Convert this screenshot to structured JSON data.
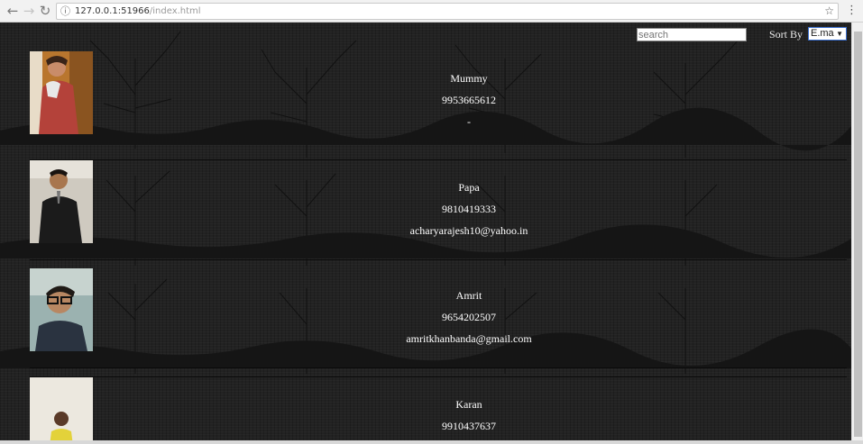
{
  "browser": {
    "url_host": "127.0.0.1:51966",
    "url_path": "/index.html",
    "star_icon": "star-icon",
    "menu_icon": "more-vert-icon"
  },
  "toolbar": {
    "search_placeholder": "search",
    "sort_label": "Sort By",
    "sort_value": "E.ma"
  },
  "contacts": [
    {
      "name": "Mummy",
      "phone": "9953665612",
      "email": "-"
    },
    {
      "name": "Papa",
      "phone": "9810419333",
      "email": "acharyarajesh10@yahoo.in"
    },
    {
      "name": "Amrit",
      "phone": "9654202507",
      "email": "amritkhanbanda@gmail.com"
    },
    {
      "name": "Karan",
      "phone": "9910437637",
      "email": ""
    }
  ],
  "colors": {
    "background": "#222222",
    "text": "#ffffff",
    "accent": "#3a6fd0"
  }
}
